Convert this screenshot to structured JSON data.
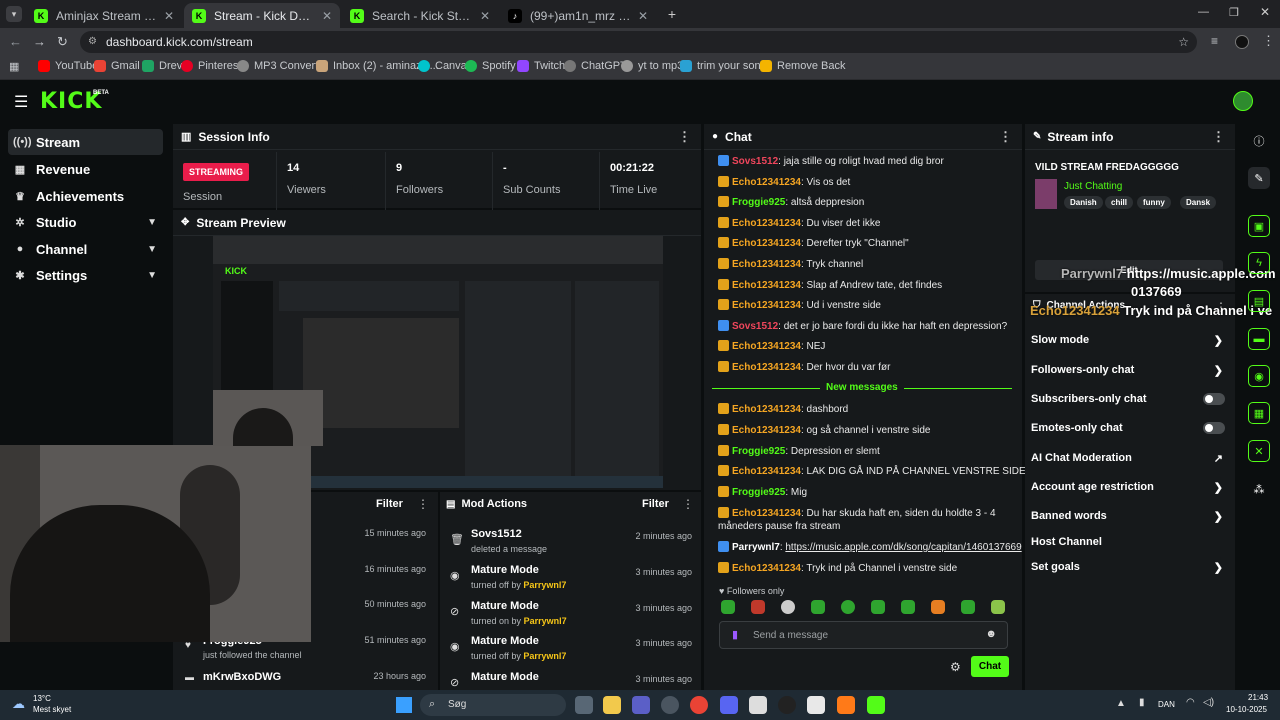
{
  "browser": {
    "tabs": [
      {
        "title": "Aminjax Stream - Watch Live o...",
        "active": false
      },
      {
        "title": "Stream - Kick Dashboard",
        "active": true
      },
      {
        "title": "Search - Kick Streaming",
        "active": false
      },
      {
        "title": "(99+)am1n_mrz (@am1n_mrz) ...",
        "active": false
      }
    ],
    "url": "dashboard.kick.com/stream",
    "bookmarks": [
      "YouTube",
      "Gmail",
      "Drev",
      "Pinterest",
      "MP3 Converter",
      "Inbox (2) - aminaziz...",
      "Canva",
      "Spotify",
      "Twitch",
      "ChatGPT",
      "yt to mp3",
      "trim your songs",
      "Remove Back"
    ]
  },
  "topnav": {
    "logo": "KICK",
    "beta": "BETA"
  },
  "sidebar": {
    "items": [
      {
        "label": "Stream",
        "icon": "broadcast-icon",
        "active": true
      },
      {
        "label": "Revenue",
        "icon": "bank-icon"
      },
      {
        "label": "Achievements",
        "icon": "trophy-icon"
      },
      {
        "label": "Studio",
        "icon": "gear-icon",
        "chevron": true
      },
      {
        "label": "Channel",
        "icon": "user-icon",
        "chevron": true
      },
      {
        "label": "Settings",
        "icon": "cog-icon",
        "chevron": true
      }
    ]
  },
  "session": {
    "title": "Session Info",
    "badge": "STREAMING",
    "session_label": "Session",
    "stats": [
      {
        "value": "14",
        "label": "Viewers"
      },
      {
        "value": "9",
        "label": "Followers"
      },
      {
        "value": "-",
        "label": "Sub Counts"
      },
      {
        "value": "00:21:22",
        "label": "Time Live"
      }
    ]
  },
  "preview": {
    "title": "Stream Preview"
  },
  "activity": {
    "filter": "Filter",
    "items": [
      {
        "title": "",
        "sub": "",
        "time": "15 minutes ago"
      },
      {
        "title": "",
        "sub": "",
        "time": "16 minutes ago"
      },
      {
        "title": "",
        "sub": "",
        "time": "50 minutes ago"
      },
      {
        "title": "Froggie925",
        "sub": "just followed the channel",
        "time": "51 minutes ago"
      },
      {
        "title": "mKrwBxoDWG",
        "sub": "",
        "time": "23 hours ago"
      }
    ]
  },
  "mod_actions": {
    "title": "Mod Actions",
    "filter": "Filter",
    "items": [
      {
        "title": "Sovs1512",
        "sub": "deleted a message",
        "by": "",
        "time": "2 minutes ago"
      },
      {
        "title": "Mature Mode",
        "sub": "turned off by",
        "by": "Parrywnl7",
        "time": "3 minutes ago"
      },
      {
        "title": "Mature Mode",
        "sub": "turned on by",
        "by": "Parrywnl7",
        "time": "3 minutes ago"
      },
      {
        "title": "Mature Mode",
        "sub": "turned off by",
        "by": "Parrywnl7",
        "time": "3 minutes ago"
      },
      {
        "title": "Mature Mode",
        "sub": "",
        "by": "",
        "time": "3 minutes ago"
      }
    ]
  },
  "chat": {
    "title": "Chat",
    "messages": [
      {
        "user": "Sovs1512",
        "color": "#f0465c",
        "badge": "blue",
        "text": ": jaja stille og roligt hvad med dig bror"
      },
      {
        "user": "Echo12341234",
        "color": "#f5a623",
        "badge": "gold",
        "text": ": Vis os det"
      },
      {
        "user": "Froggie925",
        "color": "#53fc18",
        "badge": "gold",
        "text": ": altså deppresion"
      },
      {
        "user": "Echo12341234",
        "color": "#f5a623",
        "badge": "gold",
        "text": ": Du viser det ikke"
      },
      {
        "user": "Echo12341234",
        "color": "#f5a623",
        "badge": "gold",
        "text": ": Derefter tryk \"Channel\""
      },
      {
        "user": "Echo12341234",
        "color": "#f5a623",
        "badge": "gold",
        "text": ": Tryk channel"
      },
      {
        "user": "Echo12341234",
        "color": "#f5a623",
        "badge": "gold",
        "text": ": Slap af Andrew tate, det findes"
      },
      {
        "user": "Echo12341234",
        "color": "#f5a623",
        "badge": "gold",
        "text": ": Ud i venstre side"
      },
      {
        "user": "Sovs1512",
        "color": "#f0465c",
        "badge": "blue",
        "text": ": det er jo bare fordi du ikke har haft en depression?"
      },
      {
        "user": "Echo12341234",
        "color": "#f5a623",
        "badge": "gold",
        "text": ": NEJ"
      },
      {
        "user": "Echo12341234",
        "color": "#f5a623",
        "badge": "gold",
        "text": ": Der hvor du var før"
      }
    ],
    "divider": "New messages",
    "new_messages": [
      {
        "user": "Echo12341234",
        "color": "#f5a623",
        "badge": "gold",
        "text": ": dashbord"
      },
      {
        "user": "Echo12341234",
        "color": "#f5a623",
        "badge": "gold",
        "text": ": og så channel i venstre side"
      },
      {
        "user": "Froggie925",
        "color": "#53fc18",
        "badge": "gold",
        "text": ": Depression er slemt"
      },
      {
        "user": "Echo12341234",
        "color": "#f5a623",
        "badge": "gold",
        "text": ": LAK DIG GÅ IND PÅ CHANNEL VENSTRE SIDE"
      },
      {
        "user": "Froggie925",
        "color": "#53fc18",
        "badge": "gold",
        "text": ": Mig"
      },
      {
        "user": "Echo12341234",
        "color": "#f5a623",
        "badge": "gold",
        "text": ": Du har skuda haft en, siden du holdte 3 - 4"
      },
      {
        "user": "",
        "color": "#fff",
        "badge": "",
        "text": "måneders pause fra stream"
      },
      {
        "user": "Parrywnl7",
        "color": "#ffffff",
        "badge": "blue",
        "text": ": ",
        "link": "https://music.apple.com/dk/song/capitan/1460137669"
      },
      {
        "user": "Echo12341234",
        "color": "#f5a623",
        "badge": "gold",
        "text": ": Tryk ind på Channel i venstre side"
      }
    ],
    "followers_only": "Followers only",
    "placeholder": "Send a message",
    "send": "Chat"
  },
  "stream_info": {
    "title": "Stream info",
    "stream_title": "VILD STREAM FREDAGGGGG",
    "category": "Just Chatting",
    "tags": [
      "Danish",
      "chill",
      "funny",
      "Dansk"
    ],
    "edit": "Edit"
  },
  "overlay": {
    "line1_user": "Parrywnl7",
    "line1_text": "https://music.apple.com",
    "line2_text": "0137669",
    "line3_user": "Echo12341234",
    "line3_text": "Tryk ind på Channel i ve"
  },
  "channel_actions": {
    "title": "Channel Actions",
    "items": [
      {
        "label": "Slow mode",
        "ctrl": "chevron"
      },
      {
        "label": "Followers-only chat",
        "ctrl": "chevron"
      },
      {
        "label": "Subscribers-only chat",
        "ctrl": "toggle"
      },
      {
        "label": "Emotes-only chat",
        "ctrl": "toggle"
      },
      {
        "label": "AI Chat Moderation",
        "ctrl": "external"
      },
      {
        "label": "Account age restriction",
        "ctrl": "chevron"
      },
      {
        "label": "Banned words",
        "ctrl": "chevron"
      },
      {
        "label": "Host Channel",
        "ctrl": "none"
      },
      {
        "label": "Set goals",
        "ctrl": "chevron"
      }
    ]
  },
  "taskbar": {
    "weather_temp": "13°C",
    "weather_desc": "Mest skyet",
    "search": "Søg",
    "lang": "DAN",
    "time": "21:43",
    "date": "10-10-2025"
  },
  "colors": {
    "accent": "#53fc18",
    "streaming": "#e91d4b",
    "panel": "#16191b"
  }
}
